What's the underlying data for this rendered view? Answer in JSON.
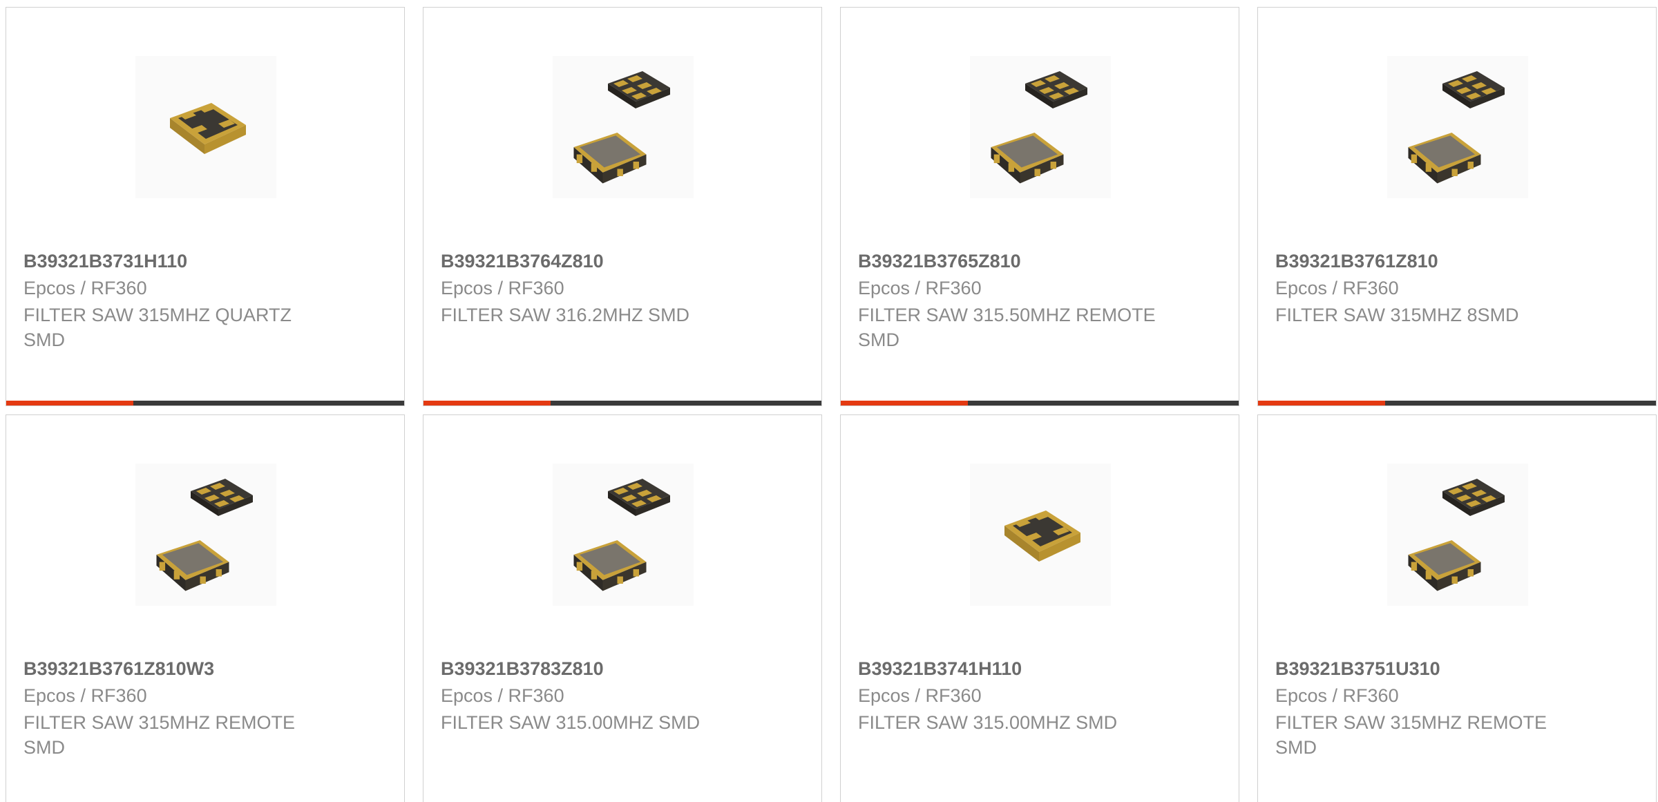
{
  "colors": {
    "accent": "#e43a12",
    "bar_track": "#3a3a3a",
    "border": "#d0d0d0",
    "title_text": "#6b6b6b",
    "body_text": "#8a8a8a"
  },
  "products": [
    {
      "part_number": "B39321B3731H110",
      "manufacturer": "Epcos / RF360",
      "description": "FILTER SAW 315MHZ QUARTZ SMD",
      "image": "saw-filter-single-icon",
      "progress": 0.32
    },
    {
      "part_number": "B39321B3764Z810",
      "manufacturer": "Epcos / RF360",
      "description": "FILTER SAW 316.2MHZ SMD",
      "image": "saw-filter-pair-icon",
      "progress": 0.32
    },
    {
      "part_number": "B39321B3765Z810",
      "manufacturer": "Epcos / RF360",
      "description": "FILTER SAW 315.50MHZ REMOTE SMD",
      "image": "saw-filter-pair-icon",
      "progress": 0.32
    },
    {
      "part_number": "B39321B3761Z810",
      "manufacturer": "Epcos / RF360",
      "description": "FILTER SAW 315MHZ 8SMD",
      "image": "saw-filter-pair-icon",
      "progress": 0.32
    },
    {
      "part_number": "B39321B3761Z810W3",
      "manufacturer": "Epcos / RF360",
      "description": "FILTER SAW 315MHZ REMOTE SMD",
      "image": "saw-filter-pair-icon",
      "progress": null
    },
    {
      "part_number": "B39321B3783Z810",
      "manufacturer": "Epcos / RF360",
      "description": "FILTER SAW 315.00MHZ SMD",
      "image": "saw-filter-pair-icon",
      "progress": null
    },
    {
      "part_number": "B39321B3741H110",
      "manufacturer": "Epcos / RF360",
      "description": "FILTER SAW 315.00MHZ SMD",
      "image": "saw-filter-single-icon",
      "progress": null
    },
    {
      "part_number": "B39321B3751U310",
      "manufacturer": "Epcos / RF360",
      "description": "FILTER SAW 315MHZ REMOTE SMD",
      "image": "saw-filter-pair-icon",
      "progress": null
    }
  ]
}
